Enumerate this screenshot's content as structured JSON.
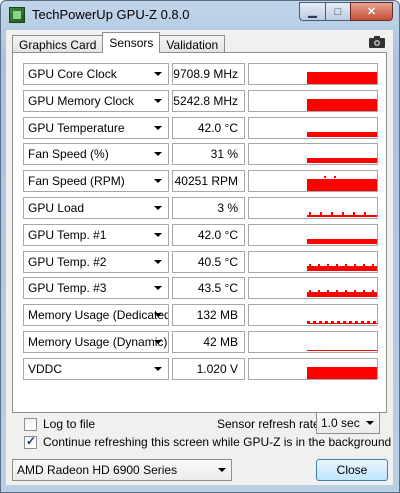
{
  "window": {
    "title": "TechPowerUp GPU-Z 0.8.0"
  },
  "tabs": [
    {
      "label": "Graphics Card",
      "active": false
    },
    {
      "label": "Sensors",
      "active": true
    },
    {
      "label": "Validation",
      "active": false
    }
  ],
  "sensors": [
    {
      "label": "GPU Core Clock",
      "value": "9708.9 MHz",
      "graph": "solid"
    },
    {
      "label": "GPU Memory Clock",
      "value": "5242.8 MHz",
      "graph": "solid"
    },
    {
      "label": "GPU Temperature",
      "value": "42.0 °C",
      "graph": "thin"
    },
    {
      "label": "Fan Speed (%)",
      "value": "31 %",
      "graph": "thin"
    },
    {
      "label": "Fan Speed (RPM)",
      "value": "40251 RPM",
      "graph": "solid-dots"
    },
    {
      "label": "GPU Load",
      "value": "3 %",
      "graph": "sparse"
    },
    {
      "label": "GPU Temp. #1",
      "value": "42.0 °C",
      "graph": "thin"
    },
    {
      "label": "GPU Temp. #2",
      "value": "40.5 °C",
      "graph": "thin-dots"
    },
    {
      "label": "GPU Temp. #3",
      "value": "43.5 °C",
      "graph": "thin-dots"
    },
    {
      "label": "Memory Usage (Dedicated)",
      "value": "132 MB",
      "graph": "low-dots"
    },
    {
      "label": "Memory Usage (Dynamic)",
      "value": "42 MB",
      "graph": "hairline"
    },
    {
      "label": "VDDC",
      "value": "1.020 V",
      "graph": "solid"
    }
  ],
  "options": {
    "log_to_file": {
      "label": "Log to file",
      "checked": false
    },
    "continue_refreshing": {
      "label": "Continue refreshing this screen while GPU-Z is in the background",
      "checked": true
    },
    "refresh_rate_label": "Sensor refresh rate:",
    "refresh_rate_value": "1.0 sec"
  },
  "footer": {
    "card_select": "AMD Radeon HD 6900 Series",
    "close_label": "Close"
  },
  "colors": {
    "graph": "#ff0000",
    "accent": "#3c7fb1"
  }
}
